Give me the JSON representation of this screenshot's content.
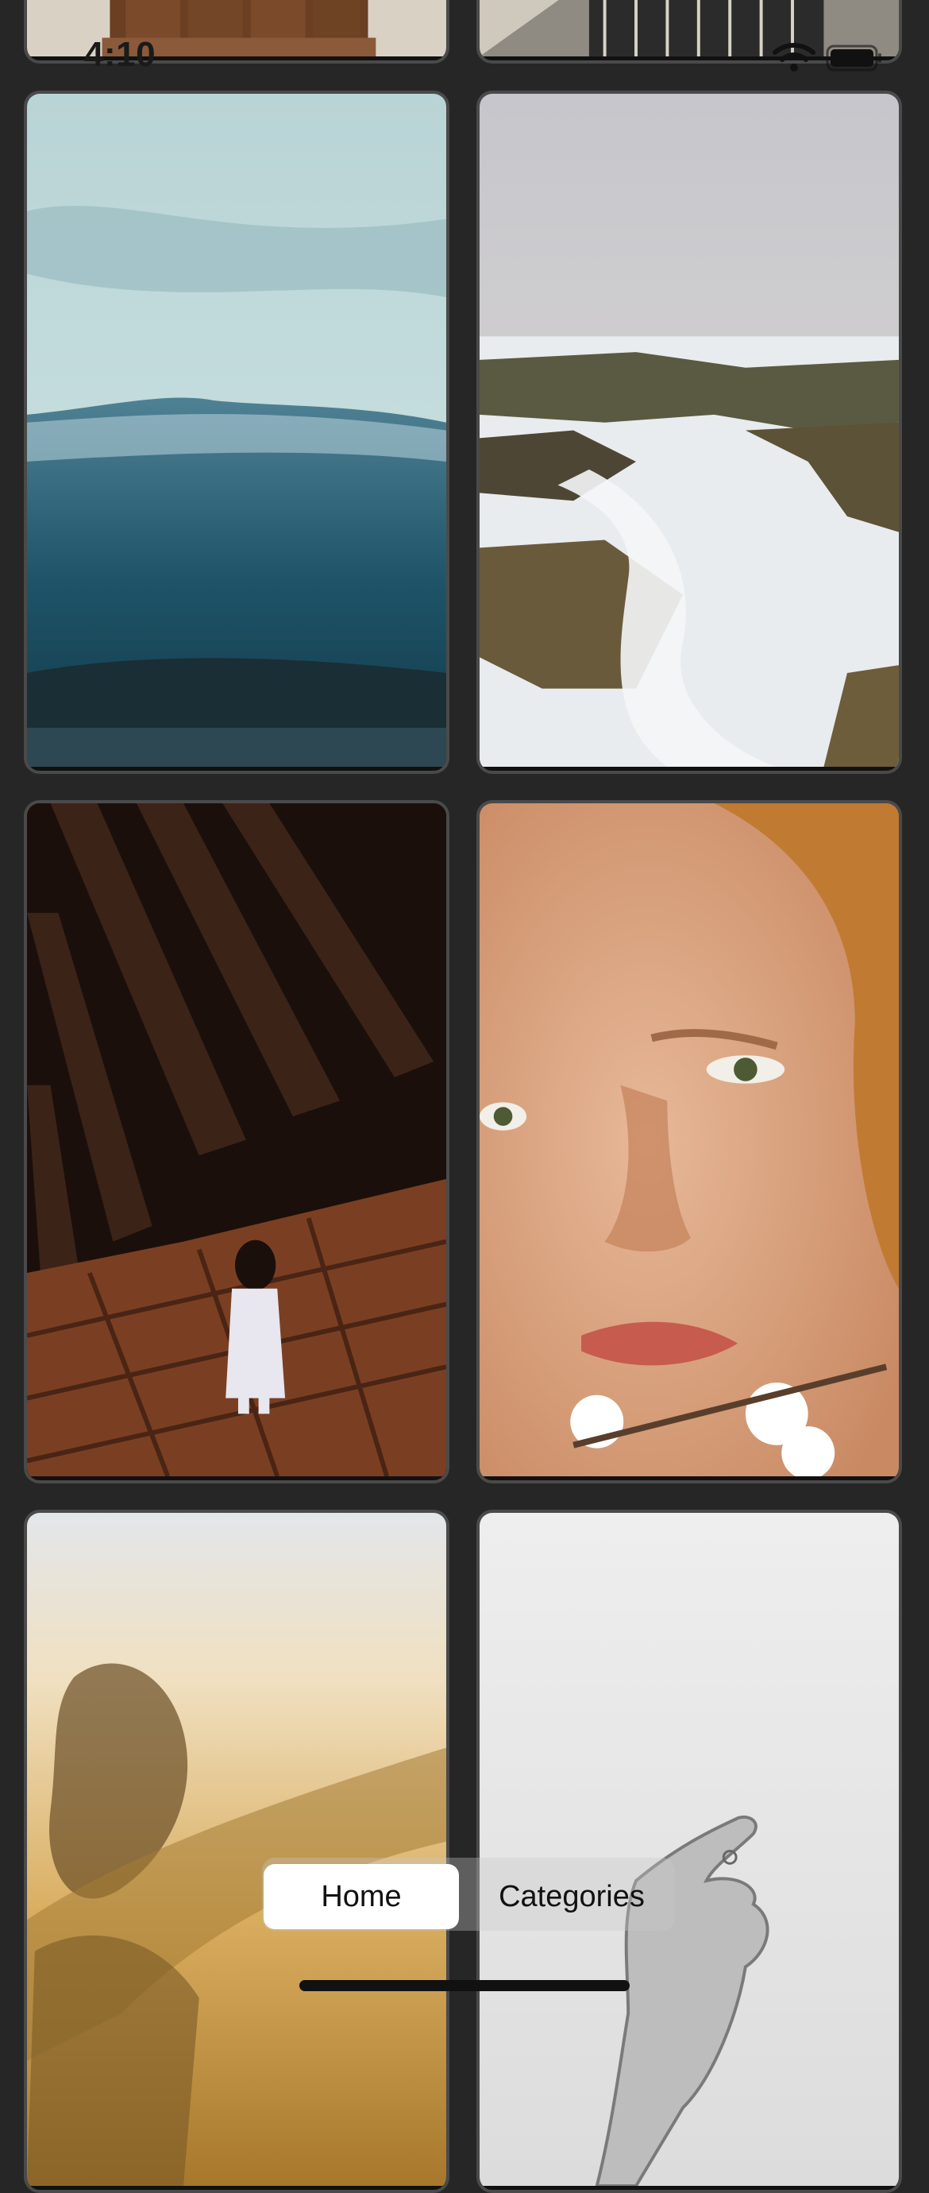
{
  "status_bar": {
    "time": "4:10",
    "wifi_icon": "wifi-icon",
    "battery_icon": "battery-icon"
  },
  "gallery": {
    "photos": [
      {
        "subject": "wooden door"
      },
      {
        "subject": "ornate iron railing"
      },
      {
        "subject": "snow-dusted teal hills"
      },
      {
        "subject": "long-exposure sea waves over rocks"
      },
      {
        "subject": "woman in white dress among church pews"
      },
      {
        "subject": "freckled woman with white blossoms"
      },
      {
        "subject": "blurred figure in golden light"
      },
      {
        "subject": "monochrome hand"
      }
    ]
  },
  "tabbar": {
    "home_label": "Home",
    "categories_label": "Categories",
    "selected": "Home"
  },
  "colors": {
    "background": "#262626",
    "tab_selected": "#ffffff",
    "text": "#111111"
  }
}
